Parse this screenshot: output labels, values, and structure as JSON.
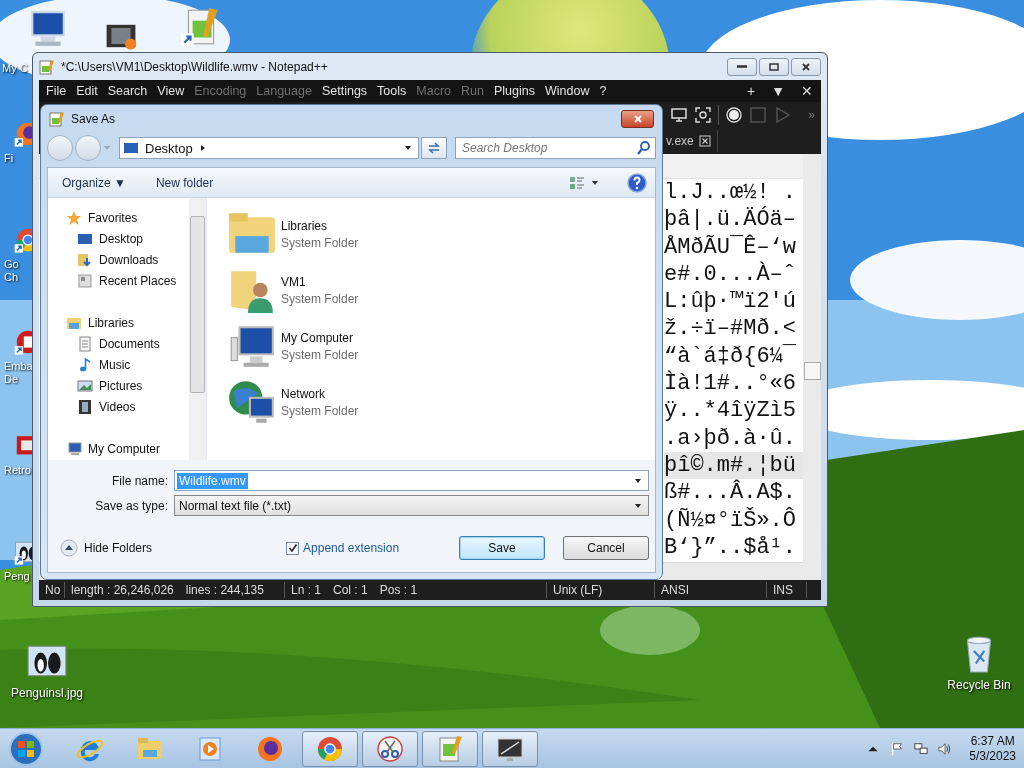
{
  "desktop": {
    "icons": [
      {
        "label": "My C",
        "kind": "computer",
        "shortcut": false
      },
      {
        "kind": "video",
        "shortcut": false
      },
      {
        "kind": "notepad",
        "shortcut": true
      },
      {
        "label": "Fi",
        "kind": "firefox",
        "shortcut": true
      },
      {
        "label": "Go Ch",
        "kind": "chrome",
        "shortcut": true
      },
      {
        "label": "Emba De",
        "kind": "app",
        "shortcut": true
      },
      {
        "label": "Retro",
        "kind": "retro",
        "shortcut": false
      },
      {
        "label": "Peng",
        "kind": "penguin",
        "shortcut": true
      },
      {
        "label": "Penguinsl.jpg",
        "kind": "penguin",
        "shortcut": false
      },
      {
        "label": "Recycle Bin",
        "kind": "recycle",
        "shortcut": false
      }
    ]
  },
  "notepad_window": {
    "title": "*C:\\Users\\VM1\\Desktop\\Wildlife.wmv - Notepad++",
    "menu": [
      {
        "label": "File",
        "disabled": false
      },
      {
        "label": "Edit",
        "disabled": false
      },
      {
        "label": "Search",
        "disabled": false
      },
      {
        "label": "View",
        "disabled": false
      },
      {
        "label": "Encoding",
        "disabled": true
      },
      {
        "label": "Language",
        "disabled": true
      },
      {
        "label": "Settings",
        "disabled": false
      },
      {
        "label": "Tools",
        "disabled": false
      },
      {
        "label": "Macro",
        "disabled": true
      },
      {
        "label": "Run",
        "disabled": true
      },
      {
        "label": "Plugins",
        "disabled": false
      },
      {
        "label": "Window",
        "disabled": false
      },
      {
        "label": "?",
        "disabled": false
      }
    ],
    "menu_controls": [
      "+",
      "▼",
      "✕"
    ],
    "toolbar_overflow": "»",
    "tab": {
      "label": "v.exe"
    },
    "lines": [
      {
        "text": "l.J..œ½! .",
        "current": false
      },
      {
        "text": "þâ|.ü.ÄÓä–",
        "current": false
      },
      {
        "text": "ÅMðÃU¯Ê–‘w",
        "current": false
      },
      {
        "text": "e#.0...À–ˆ",
        "current": false
      },
      {
        "text": "L:ûþ·™ï2'ú",
        "current": false
      },
      {
        "text": "ž.÷ï–#Mð.<",
        "current": false
      },
      {
        "text": "“à`á‡ð{6¼¯",
        "current": false
      },
      {
        "text": "Ìà!1#..°«6",
        "current": false
      },
      {
        "text": "ÿ..*4îÿZì5",
        "current": false
      },
      {
        "text": ".a›þð.à·û.",
        "current": false
      },
      {
        "text": "þî©.m#.¦bü",
        "current": true
      },
      {
        "text": "ß#...Â.A$.",
        "current": false
      },
      {
        "text": "(Ñ½¤°ïŠ».Ô",
        "current": false
      },
      {
        "text": "B‘}”..$å¹.",
        "current": false
      }
    ],
    "status_bar": [
      [
        "No"
      ],
      [
        "length : 26,246,026",
        "lines : 244,135"
      ],
      [
        "Ln : 1",
        "Col : 1",
        "Pos : 1"
      ],
      [
        "Unix (LF)"
      ],
      [
        "ANSI"
      ],
      [
        "INS"
      ]
    ]
  },
  "save_dialog": {
    "title": "Save As",
    "address": "Desktop",
    "search": {
      "placeholder": "Search Desktop"
    },
    "commands": [
      "Organize ▼",
      "New folder"
    ],
    "nav": [
      {
        "label": "Favorites",
        "kind": "star",
        "children": [
          {
            "label": "Desktop",
            "kind": "desktop"
          },
          {
            "label": "Downloads",
            "kind": "downloads"
          },
          {
            "label": "Recent Places",
            "kind": "recent"
          }
        ]
      },
      {
        "label": "Libraries",
        "kind": "libraries",
        "children": [
          {
            "label": "Documents",
            "kind": "documents"
          },
          {
            "label": "Music",
            "kind": "music"
          },
          {
            "label": "Pictures",
            "kind": "pictures"
          },
          {
            "label": "Videos",
            "kind": "videos"
          }
        ]
      },
      {
        "label": "My Computer",
        "kind": "computer"
      }
    ],
    "items": [
      {
        "name": "Libraries",
        "type": "System Folder",
        "kind": "libraries"
      },
      {
        "name": "VM1",
        "type": "System Folder",
        "kind": "user"
      },
      {
        "name": "My Computer",
        "type": "System Folder",
        "kind": "computer"
      },
      {
        "name": "Network",
        "type": "System Folder",
        "kind": "network"
      }
    ],
    "file_name": {
      "label": "File name:",
      "value": "Wildlife.wmv",
      "text_selected": true
    },
    "save_as_type": {
      "label": "Save as type:",
      "value": "Normal text file (*.txt)"
    },
    "hide_folders": "Hide Folders",
    "append_extension": {
      "label": "Append extension",
      "checked": true
    },
    "buttons": [
      "Save",
      "Cancel"
    ]
  },
  "taskbar": {
    "apps": [
      {
        "kind": "ie",
        "running": false
      },
      {
        "kind": "explorer",
        "running": false
      },
      {
        "kind": "media",
        "running": false
      },
      {
        "kind": "firefox",
        "running": false
      },
      {
        "kind": "chrome",
        "running": true
      },
      {
        "kind": "snipping",
        "running": true
      },
      {
        "kind": "notepad",
        "running": true
      },
      {
        "kind": "display",
        "running": true
      }
    ],
    "clock": {
      "time": "6:37 AM",
      "date": "5/3/2023"
    }
  }
}
